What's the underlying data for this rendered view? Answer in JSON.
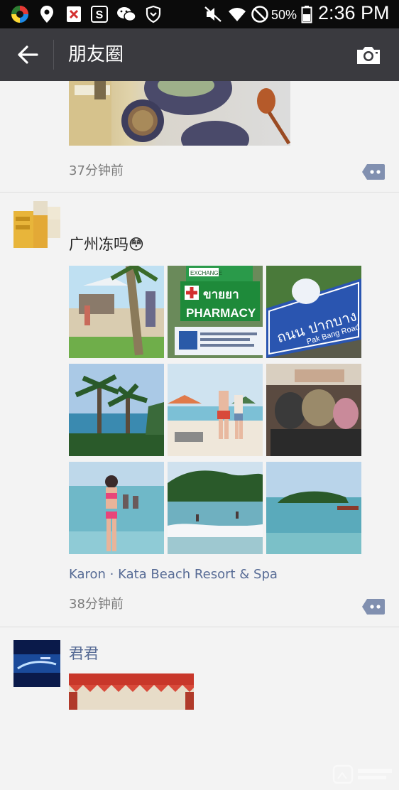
{
  "status_bar": {
    "battery_percent": "50%",
    "time": "2:36 PM",
    "icons": [
      "app-icon",
      "location-icon",
      "blocked-icon",
      "s-app-icon",
      "wechat-icon",
      "shield-icon",
      "mute-icon",
      "wifi-icon",
      "no-sim-icon",
      "battery-icon"
    ]
  },
  "toolbar": {
    "title": "朋友圈",
    "back_icon": "back-arrow-icon",
    "camera_icon": "camera-icon"
  },
  "posts": [
    {
      "time": "37分钟前"
    },
    {
      "text": "广州冻吗😳",
      "photos": [
        "beach-bar",
        "pharmacy-sign",
        "pak-bang-road-sign",
        "palm-trees",
        "beach-couple",
        "people-sitting",
        "girl-in-bikini",
        "beach-waves",
        "island-sea"
      ],
      "location": "Karon · Kata Beach Resort & Spa",
      "time": "38分钟前"
    },
    {
      "name": "君君"
    }
  ],
  "colors": {
    "link": "#576b95",
    "toolbar": "#3a3a3f",
    "background": "#f3f3f3"
  }
}
